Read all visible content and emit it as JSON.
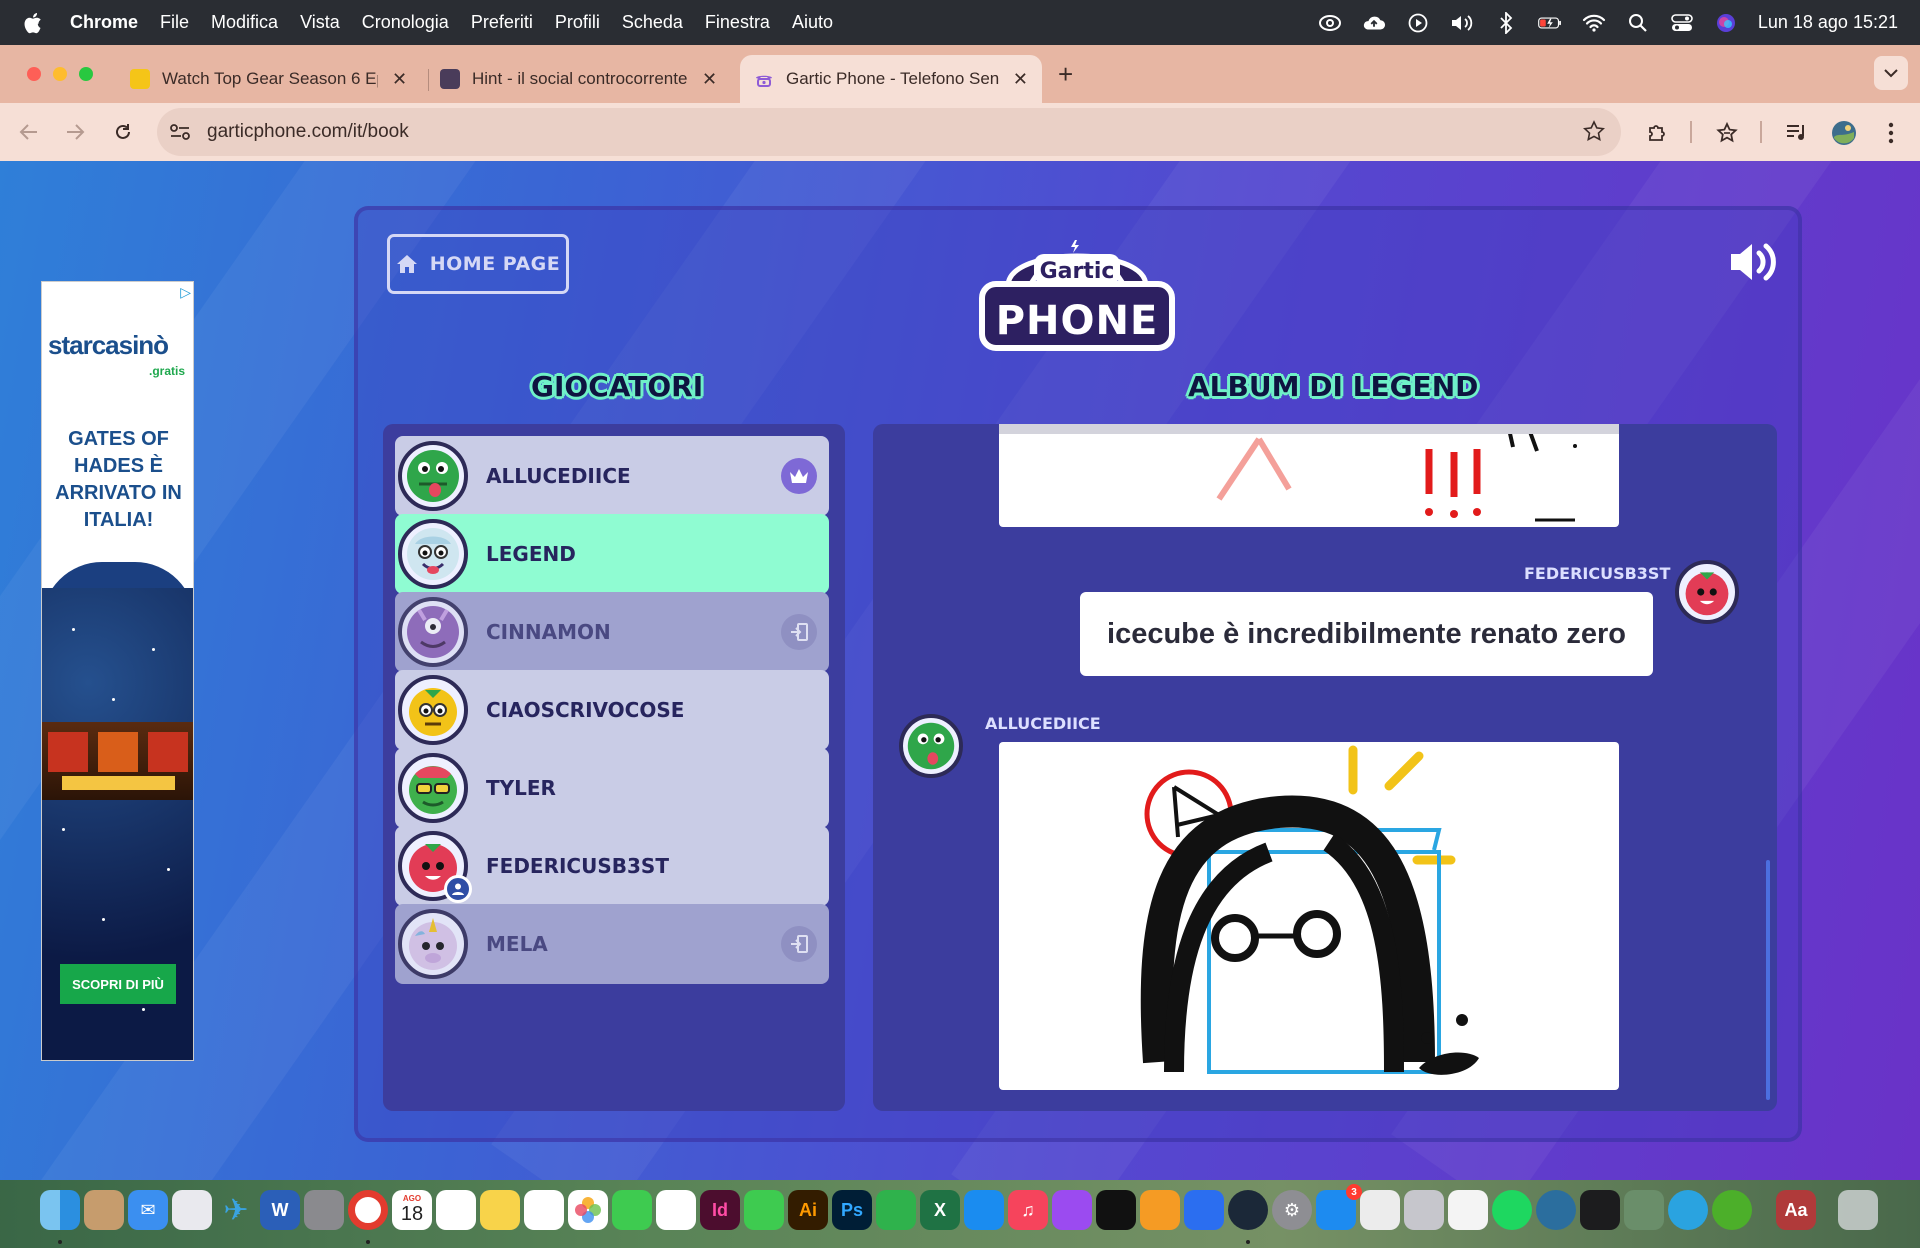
{
  "menubar": {
    "app": "Chrome",
    "items": [
      "File",
      "Modifica",
      "Vista",
      "Cronologia",
      "Preferiti",
      "Profili",
      "Scheda",
      "Finestra",
      "Aiuto"
    ],
    "clock": "Lun 18 ago  15:21"
  },
  "browser": {
    "tabs": [
      {
        "title": "Watch Top Gear Season 6 Epi",
        "favicon_color": "#f5c518"
      },
      {
        "title": "Hint - il social controcorrente",
        "favicon_color": "#4a3c5a"
      },
      {
        "title": "Gartic Phone - Telefono Senz",
        "favicon_color": "#8e5bd6"
      }
    ],
    "url": "garticphone.com/it/book"
  },
  "ad": {
    "adchoices": "▷",
    "logo": "starcasinò",
    "logo_sub": ".gratis",
    "headline": "GATES OF HADES È ARRIVATO IN ITALIA!",
    "cta": "SCOPRI DI PIÙ"
  },
  "game": {
    "home_button": "HOME PAGE",
    "logo_top": "Gartic",
    "logo_bottom": "PHONE",
    "players_title": "GIOCATORI",
    "album_title": "ALBUM DI LEGEND",
    "players": [
      {
        "name": "ALLUCEDIICE",
        "state": "host",
        "color": "#2fa64a"
      },
      {
        "name": "LEGEND",
        "state": "me",
        "color": "#cfe6f0"
      },
      {
        "name": "CINNAMON",
        "state": "away",
        "color": "#8b5fb5"
      },
      {
        "name": "CIAOSCRIVOCOSE",
        "state": "normal",
        "color": "#f2c318"
      },
      {
        "name": "TYLER",
        "state": "normal",
        "color": "#3fb04c"
      },
      {
        "name": "FEDERICUSB3ST",
        "state": "user",
        "color": "#e23c56"
      },
      {
        "name": "MELA",
        "state": "away",
        "color": "#d9c6e8"
      }
    ],
    "album": {
      "entry_text_author": "FEDERICUSB3ST",
      "entry_text": "icecube è incredibilmente renato zero",
      "entry_drawing_author": "ALLUCEDIICE"
    }
  },
  "dock": {
    "calendar_month": "AGO",
    "calendar_day": "18",
    "badge": "3"
  }
}
